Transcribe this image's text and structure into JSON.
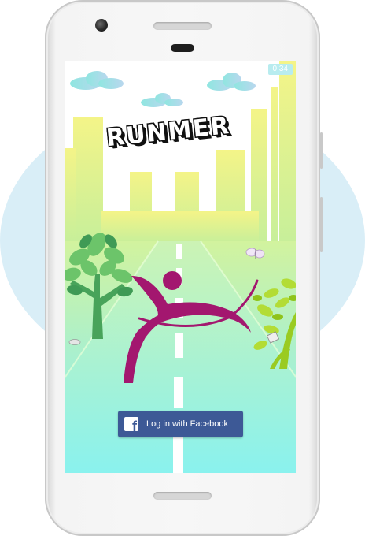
{
  "app": {
    "title": "RUNMER",
    "status_time": "0:34"
  },
  "login": {
    "facebook_label": "Log in with Facebook",
    "facebook_icon_glyph": "f",
    "icon": "facebook-icon"
  },
  "colors": {
    "facebook_blue": "#3d5996",
    "runner_magenta": "#a3176f",
    "tree_green": "#5cb85c",
    "tree_lime": "#a6d62a",
    "road_cyan": "#aef1e8",
    "sky_yellow": "#f2f48b"
  }
}
